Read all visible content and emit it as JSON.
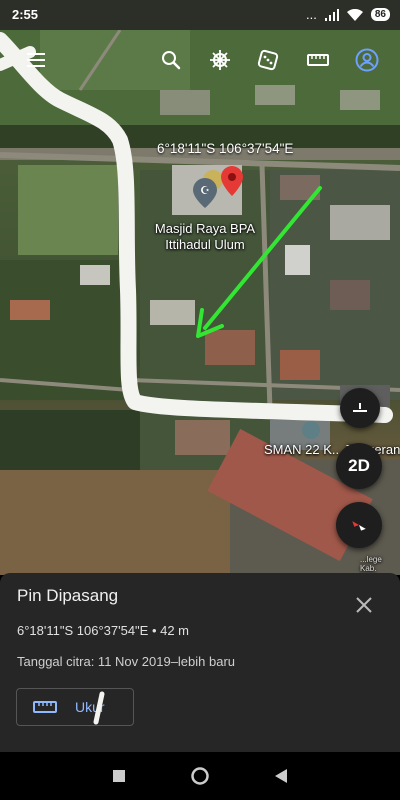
{
  "status_bar": {
    "time": "2:55",
    "signal": "...",
    "battery": "86"
  },
  "map": {
    "coordinates_label": "6°18'11\"S 106°37'54\"E",
    "places": {
      "masjid": "Masjid Raya BPA Ittihadul Ulum",
      "sman": "SMAN 22 K... Tangeran...",
      "small": "...lege Kab. Tange..."
    },
    "view_mode_button": "2D",
    "icons": {
      "menu": "menu-icon",
      "search": "search-icon",
      "voyager": "ship-wheel-icon",
      "random": "dice-icon",
      "measure": "ruler-icon",
      "account": "account-icon",
      "compass": "compass-icon",
      "pin": "map-pin-icon"
    },
    "annotation_colors": {
      "path": "#ffffff",
      "arrow": "#33e633",
      "pin": "#e53935"
    }
  },
  "card": {
    "title": "Pin Dipasang",
    "coordinates": "6°18'11\"S 106°37'54\"E • 42 m",
    "imagery_date": "Tanggal citra: 11 Nov 2019–lebih baru",
    "measure_label": "Ukur"
  }
}
